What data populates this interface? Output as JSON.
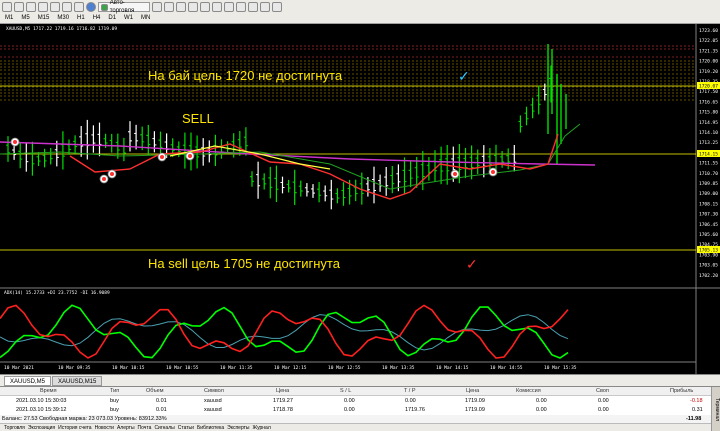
{
  "toolbar": {
    "autotrade_label": "Авто-торговля",
    "timeframes": [
      "M1",
      "M5",
      "M15",
      "M30",
      "H1",
      "H4",
      "D1",
      "W1",
      "MN"
    ]
  },
  "chart": {
    "header": "XAUUSD,M5  1717.22 1719.16 1716.82 1719.09",
    "indicator_header": "ADX(14) 15.2733  +DI 23.7752  -DI 16.9089",
    "price_labels": [
      "1723.60",
      "1722.05",
      "1721.35",
      "1720.00",
      "1719.20",
      "1718.35",
      "1717.50",
      "1716.65",
      "1715.80",
      "1714.95",
      "1714.10",
      "1713.25",
      "1712.40",
      "1711.55",
      "1710.70",
      "1709.85",
      "1709.00",
      "1708.15",
      "1707.30",
      "1706.45",
      "1705.60",
      "1704.75",
      "1703.90",
      "1703.05",
      "1702.20"
    ],
    "highlight_prices": {
      "top": "1720.07",
      "middle": "1714.15",
      "bottom": "1705.13"
    },
    "time_labels": [
      "10 Mar 2021",
      "10 Mar 09:35",
      "10 Mar 10:15",
      "10 Mar 10:55",
      "10 Mar 11:35",
      "10 Mar 12:15",
      "10 Mar 12:55",
      "10 Mar 13:35",
      "10 Mar 14:15",
      "10 Mar 14:55",
      "10 Mar 15:35"
    ],
    "annotations": {
      "buy_target": "На бай цель 1720  не достигнута",
      "sell_label": "SELL",
      "sell_target": "На sell цель 1705  не достигнута"
    },
    "colors": {
      "background": "#000000",
      "bull": "#00e000",
      "bear": "#ff3030",
      "ma_magenta": "#cc33cc",
      "annotation": "#ffe600"
    }
  },
  "tabs": [
    "XAUUSD,M5",
    "XAUUSD,M15"
  ],
  "terminal": {
    "columns": [
      "Время",
      "Тип",
      "Объем",
      "Символ",
      "Цена",
      "S / L",
      "T / P",
      "Цена",
      "Комиссия",
      "Своп",
      "Прибыль"
    ],
    "rows": [
      {
        "time": "2021.03.10 15:30:03",
        "type": "buy",
        "volume": "0.01",
        "symbol": "xauusd",
        "price": "1719.27",
        "sl": "0.00",
        "tp": "0.00",
        "cur": "1719.09",
        "commission": "0.00",
        "swap": "0.00",
        "profit": "-0.18"
      },
      {
        "time": "2021.03.10 15:39:12",
        "type": "buy",
        "volume": "0.01",
        "symbol": "xauusd",
        "price": "1718.78",
        "sl": "0.00",
        "tp": "1719.76",
        "cur": "1719.09",
        "commission": "0.00",
        "swap": "0.00",
        "profit": "0.31"
      }
    ],
    "summary": "Баланс: 27.53  Свободная маржа: 23 073.03  Уровень: 83912.33%",
    "total": "-11.98",
    "side": "Терминал",
    "bottom_tabs": [
      "Торговля",
      "Экспозиция",
      "История счета",
      "Новости",
      "Алерты",
      "Почта",
      "Сигналы",
      "Статьи",
      "Библиотека",
      "Эксперты",
      "Журнал"
    ]
  }
}
